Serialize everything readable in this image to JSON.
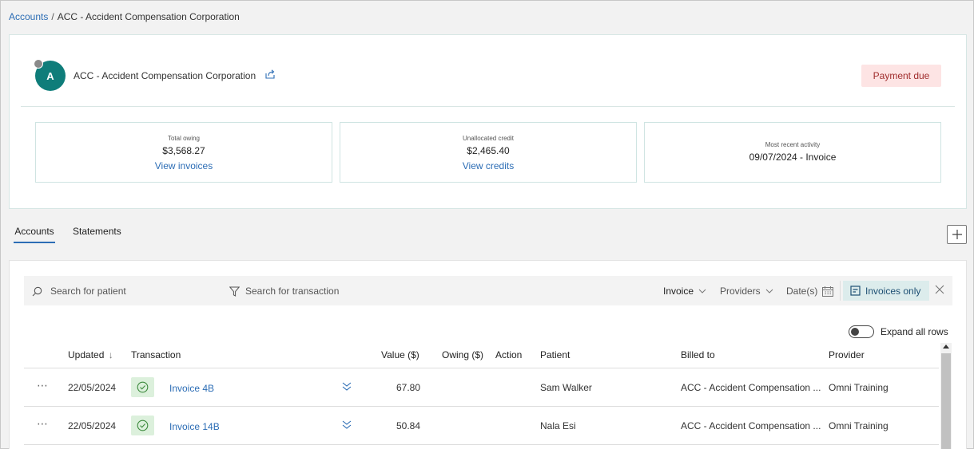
{
  "breadcrumb": {
    "root": "Accounts",
    "separator": "/",
    "current": "ACC - Accident Compensation Corporation"
  },
  "account": {
    "avatar_initial": "A",
    "name": "ACC - Accident Compensation Corporation",
    "share_icon": "share-icon",
    "status_badge": "Payment due"
  },
  "stats": [
    {
      "label": "Total owing",
      "value": "$3,568.27",
      "link": "View invoices"
    },
    {
      "label": "Unallocated credit",
      "value": "$2,465.40",
      "link": "View credits"
    },
    {
      "label": "Most recent activity",
      "value": "09/07/2024 - Invoice"
    }
  ],
  "tabs": [
    {
      "label": "Accounts",
      "active": true
    },
    {
      "label": "Statements",
      "active": false
    }
  ],
  "filters": {
    "search_patient": "Search for patient",
    "search_transaction": "Search for transaction",
    "type_selected": "Invoice",
    "providers": "Providers",
    "dates": "Date(s)",
    "invoices_only": "Invoices only"
  },
  "expand_all": {
    "label": "Expand all rows",
    "on": false
  },
  "table": {
    "columns": [
      "Updated",
      "Transaction",
      "Value ($)",
      "Owing ($)",
      "Action",
      "Patient",
      "Billed to",
      "Provider"
    ],
    "sort_indicator": "↓",
    "rows": [
      {
        "updated": "22/05/2024",
        "transaction": "Invoice 4B",
        "value": "67.80",
        "owing": "",
        "action": "",
        "patient": "Sam Walker",
        "billed_to": "ACC - Accident Compensation ...",
        "provider": "Omni Training"
      },
      {
        "updated": "22/05/2024",
        "transaction": "Invoice 14B",
        "value": "50.84",
        "owing": "",
        "action": "",
        "patient": "Nala Esi",
        "billed_to": "ACC - Accident Compensation ...",
        "provider": "Omni Training"
      }
    ]
  },
  "colors": {
    "accent_link": "#2c6db5",
    "avatar_bg": "#0f7d7a",
    "badge_bg": "#fde4e4",
    "badge_text": "#a02d2d",
    "invoices_only_bg": "#dcecec",
    "status_ok_bg": "#dcf0dc"
  }
}
